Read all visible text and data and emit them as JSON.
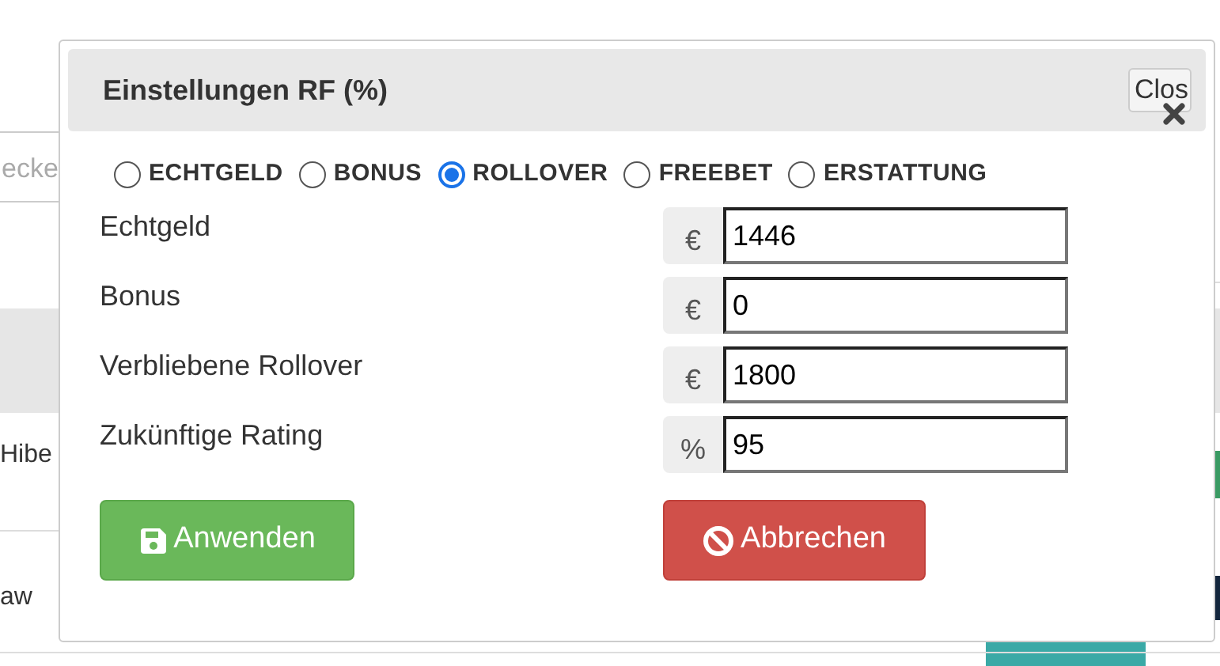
{
  "background": {
    "search_placeholder": "ecke",
    "rows": [
      {
        "text": "Hibe"
      },
      {
        "text": "aw"
      }
    ]
  },
  "dialog": {
    "title": "Einstellungen RF (%)",
    "close_label": "Clos",
    "options": [
      {
        "label": "ECHTGELD",
        "selected": false
      },
      {
        "label": "BONUS",
        "selected": false
      },
      {
        "label": "ROLLOVER",
        "selected": true
      },
      {
        "label": "FREEBET",
        "selected": false
      },
      {
        "label": "ERSTATTUNG",
        "selected": false
      }
    ],
    "fields": [
      {
        "label": "Echtgeld",
        "addon": "€",
        "value": "1446"
      },
      {
        "label": "Bonus",
        "addon": "€",
        "value": "0"
      },
      {
        "label": "Verbliebene Rollover",
        "addon": "€",
        "value": "1800"
      },
      {
        "label": "Zukünftige Rating",
        "addon": "%",
        "value": "95"
      }
    ],
    "buttons": [
      {
        "kind": "apply",
        "label": "Anwenden"
      },
      {
        "kind": "cancel",
        "label": "Abbrechen"
      }
    ]
  }
}
